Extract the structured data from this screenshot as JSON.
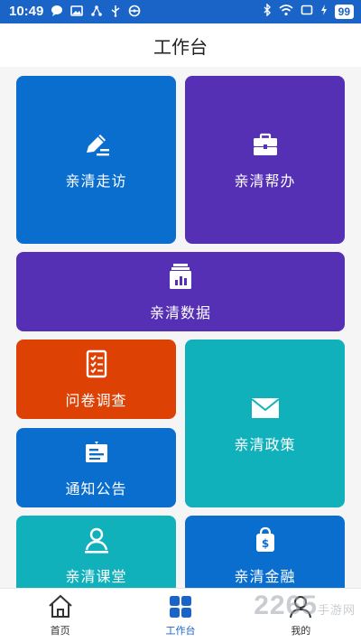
{
  "status_bar": {
    "time": "10:49",
    "battery": "99",
    "left_icons": [
      "chat-icon",
      "image-icon",
      "share-icon",
      "usb-icon",
      "steering-icon"
    ],
    "right_icons": [
      "bluetooth-icon",
      "wifi-icon",
      "screen-icon",
      "charging-icon"
    ]
  },
  "header": {
    "title": "工作台"
  },
  "tiles": {
    "visit": {
      "label": "亲清走访",
      "icon": "pen-edit-icon",
      "color": "#0a6ecf"
    },
    "help": {
      "label": "亲清帮办",
      "icon": "briefcase-icon",
      "color": "#5530b4"
    },
    "data": {
      "label": "亲清数据",
      "icon": "data-box-icon",
      "color": "#5530b4"
    },
    "survey": {
      "label": "问卷调查",
      "icon": "checklist-icon",
      "color": "#dd4104"
    },
    "policy": {
      "label": "亲清政策",
      "icon": "envelope-icon",
      "color": "#11b1bc"
    },
    "notice": {
      "label": "通知公告",
      "icon": "notice-icon",
      "color": "#0a6ecf"
    },
    "class": {
      "label": "亲清课堂",
      "icon": "teacher-icon",
      "color": "#11b1bc"
    },
    "finance": {
      "label": "亲清金融",
      "icon": "money-bag-icon",
      "color": "#0a6ecf"
    }
  },
  "tabbar": {
    "items": [
      {
        "label": "首页",
        "icon": "home-icon"
      },
      {
        "label": "工作台",
        "icon": "grid-icon",
        "active": true
      },
      {
        "label": "我的",
        "icon": "user-icon"
      }
    ],
    "active_color": "#1a64c8"
  },
  "watermark": {
    "brand": "2265",
    "suffix": "手游网"
  }
}
